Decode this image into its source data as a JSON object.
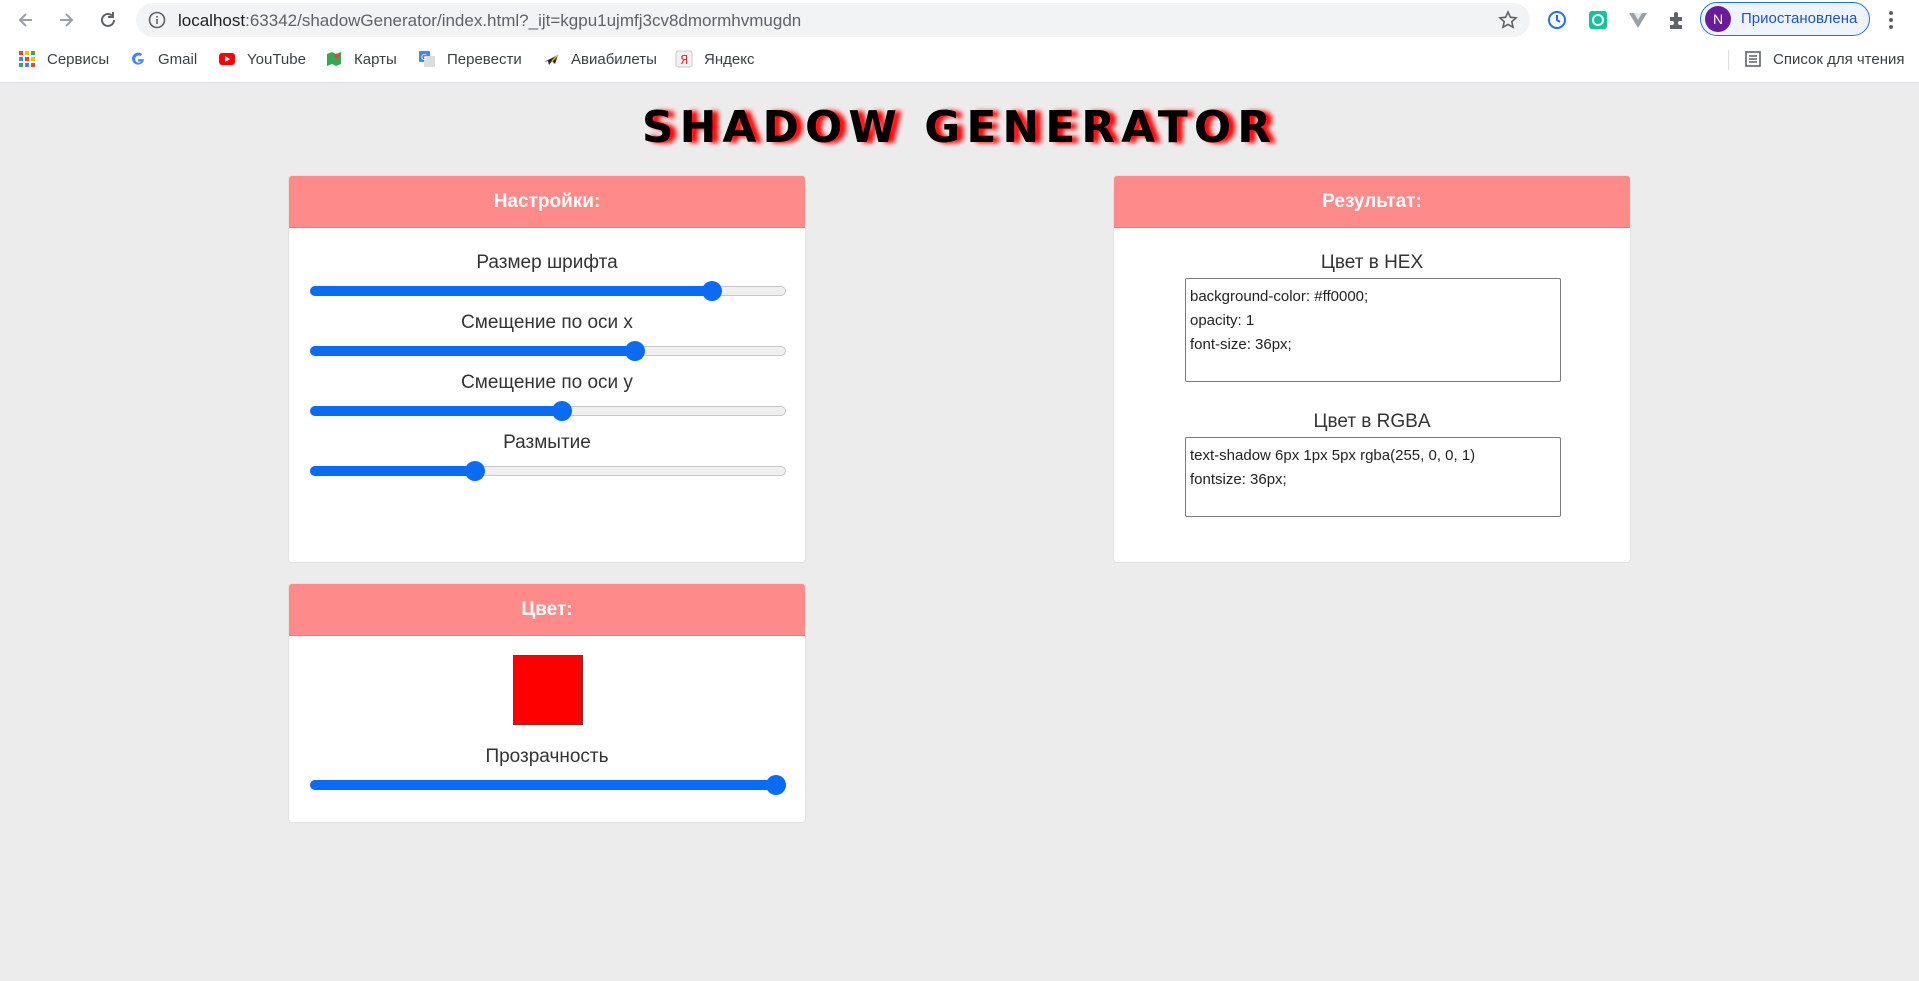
{
  "browser": {
    "url_host": "localhost",
    "url_rest": ":63342/shadowGenerator/index.html?_ijt=kgpu1ujmfj3cv8dmormhvmugdn",
    "profile_initial": "N",
    "profile_label": "Приостановлена",
    "reading_list_label": "Список для чтения",
    "bookmarks": [
      "Сервисы",
      "Gmail",
      "YouTube",
      "Карты",
      "Перевести",
      "Авиабилеты",
      "Яндекс"
    ]
  },
  "page": {
    "title": "SHADOW GENERATOR"
  },
  "settings": {
    "header": "Настройки:",
    "sliders": [
      {
        "label": "Размер шрифта",
        "value_pct": 86
      },
      {
        "label": "Смещение по оси x",
        "value_pct": 69
      },
      {
        "label": "Смещение по оси y",
        "value_pct": 53
      },
      {
        "label": "Размытие",
        "value_pct": 34
      }
    ]
  },
  "result": {
    "header": "Результат:",
    "hex_label": "Цвет в HEX",
    "hex_lines": [
      "background-color: #ff0000;",
      "opacity: 1",
      "font-size: 36px;"
    ],
    "rgba_label": "Цвет в RGBA",
    "rgba_lines": [
      "text-shadow 6px 1px 5px rgba(255, 0, 0, 1)",
      "fontsize: 36px;"
    ]
  },
  "color": {
    "header": "Цвет:",
    "swatch_color": "#ff0000",
    "opacity_label": "Прозрачность",
    "opacity_pct": 100
  },
  "colors": {
    "card_header": "#ff8a8a",
    "slider_accent": "#0a6cf2",
    "page_bg": "#ececec"
  }
}
